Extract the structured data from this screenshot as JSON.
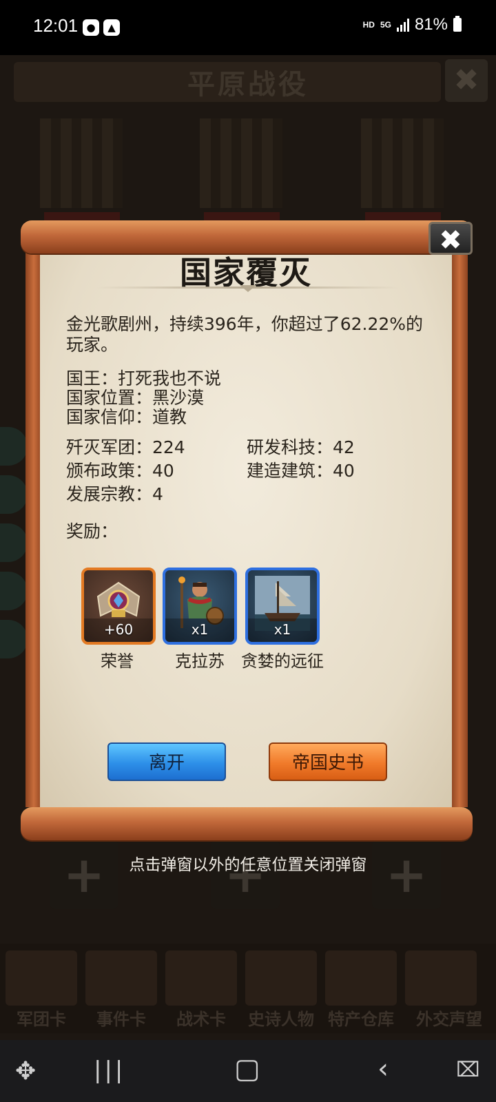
{
  "status_bar": {
    "time": "12:01",
    "network_badge": "HD",
    "network_type": "5G",
    "battery": "81%"
  },
  "game_background": {
    "title": "平原战役",
    "bottom_tabs": [
      "军团卡",
      "事件卡",
      "战术卡",
      "史诗人物",
      "特产仓库",
      "外交声望"
    ]
  },
  "dialog": {
    "title": "国家覆灭",
    "summary": "金光歌剧州，持续396年，你超过了62.22%的玩家。",
    "king": "国王：打死我也不说",
    "location": "国家位置：黑沙漠",
    "religion": "国家信仰：道教",
    "stats": {
      "legions_destroyed": "歼灭军团：224",
      "tech_researched": "研发科技：42",
      "policies_issued": "颁布政策：40",
      "buildings_built": "建造建筑：40",
      "religions_developed": "发展宗教：4"
    },
    "rewards_label": "奖励：",
    "rewards": [
      {
        "name": "荣誉",
        "count": "+60",
        "frame_color": "#e37a23"
      },
      {
        "name": "克拉苏",
        "count": "x1",
        "frame_color": "#2e6fe0"
      },
      {
        "name": "贪婪的远征",
        "count": "x1",
        "frame_color": "#2e6fe0"
      }
    ],
    "buttons": {
      "leave": "离开",
      "history": "帝国史书"
    },
    "close_glyph": "✖"
  },
  "hint": "点击弹窗以外的任意位置关闭弹窗",
  "colors": {
    "parchment": "#ece3d0",
    "scroll_wood": "#c1683a",
    "leave_button": "#2d8fe8",
    "history_button": "#f07a2a"
  }
}
